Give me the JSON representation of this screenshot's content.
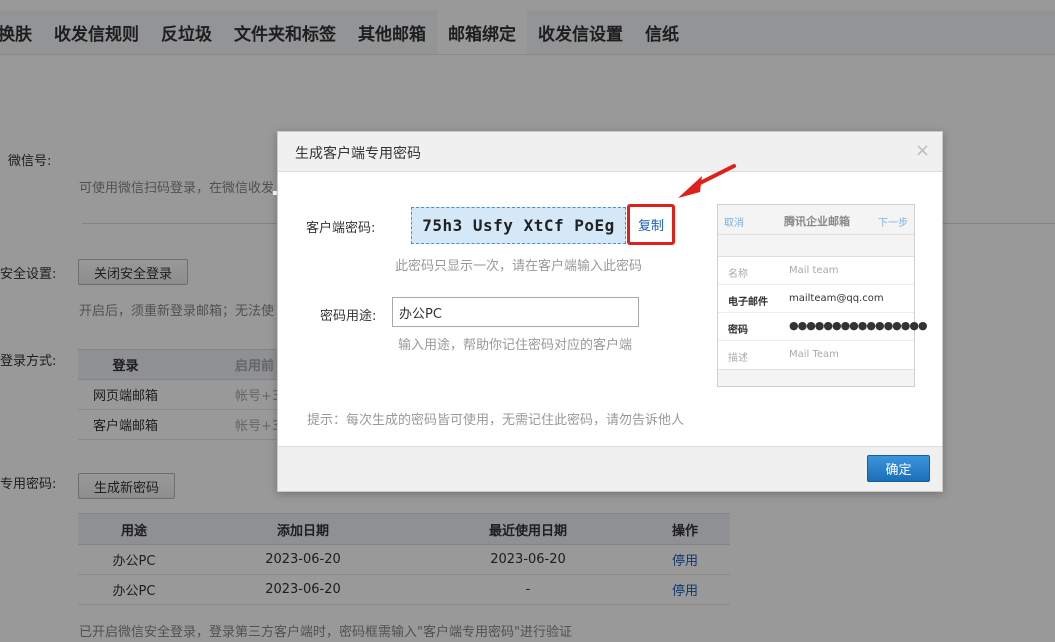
{
  "topnav": {
    "tabs": [
      {
        "label": "换肤"
      },
      {
        "label": "收发信规则"
      },
      {
        "label": "反垃圾"
      },
      {
        "label": "文件夹和标签"
      },
      {
        "label": "其他邮箱"
      },
      {
        "label": "邮箱绑定"
      },
      {
        "label": "收发信设置"
      },
      {
        "label": "信纸"
      }
    ],
    "active_tab": "邮箱绑定"
  },
  "settings": {
    "wechat_label": "微信号:",
    "wechat_hint": "可使用微信扫码登录，在微信收发",
    "security_label": "安全设置:",
    "security_button": "关闭安全登录",
    "security_hint": "开启后，须重新登录邮箱；无法使",
    "login_method_label": "登录方式:",
    "login_table": {
      "headers": [
        "登录",
        "启用前"
      ],
      "rows": [
        {
          "name": "网页端邮箱",
          "value": "帐号+3"
        },
        {
          "name": "客户端邮箱",
          "value": "帐号+3"
        }
      ]
    },
    "client_pw_label": "专用密码:",
    "generate_button": "生成新密码",
    "pw_table": {
      "headers": [
        "用途",
        "添加日期",
        "最近使用日期",
        "操作"
      ],
      "rows": [
        {
          "purpose": "办公PC",
          "added": "2023-06-20",
          "last_used": "2023-06-20",
          "action": "停用"
        },
        {
          "purpose": "办公PC",
          "added": "2023-06-20",
          "last_used": "-",
          "action": "停用"
        }
      ]
    },
    "footer_note": "已开启微信安全登录，登录第三方客户端时，密码框需输入\"客户端专用密码\"进行验证"
  },
  "dialog": {
    "title": "生成客户端专用密码",
    "close_symbol": "×",
    "password_label": "客户端密码:",
    "password_value": "75h3 Usfy XtCf PoEg",
    "copy_label": "复制",
    "password_hint": "此密码只显示一次，请在客户端输入此密码",
    "purpose_label": "密码用途:",
    "purpose_value": "办公PC",
    "purpose_hint": "输入用途，帮助你记住密码对应的客户端",
    "tip": "提示：每次生成的密码皆可使用，无需记住此密码，请勿告诉他人",
    "ok_label": "确定"
  },
  "mock": {
    "cancel": "取消",
    "title": "腾讯企业邮箱",
    "next": "下一步",
    "rows": [
      {
        "key": "名称",
        "value": "Mail team"
      },
      {
        "key": "电子邮件",
        "value": "mailteam@qq.com"
      },
      {
        "key": "密码",
        "value": "●●●●●●●●●●●●●●●●"
      },
      {
        "key": "描述",
        "value": "Mail Team"
      }
    ]
  },
  "colors": {
    "accent_blue": "#1a5fb4",
    "highlight_red": "#e0201b",
    "password_bg": "#d5e8f7",
    "ok_button": "#2a82c9"
  }
}
